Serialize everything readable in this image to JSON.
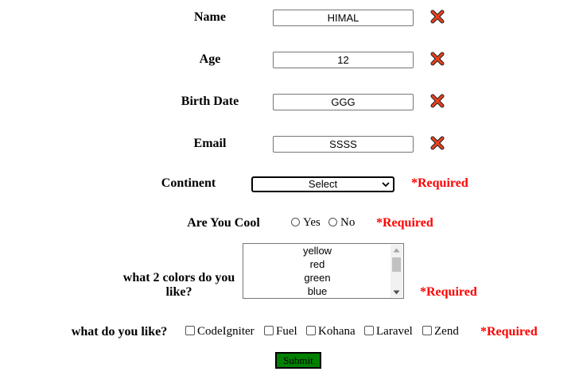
{
  "form": {
    "fields": [
      {
        "label": "Name",
        "value": "HIMAL"
      },
      {
        "label": "Age",
        "value": "12"
      },
      {
        "label": "Birth Date",
        "value": "GGG"
      },
      {
        "label": "Email",
        "value": "SSSS"
      }
    ],
    "continent": {
      "label": "Continent",
      "selected": "Select",
      "required": "*Required"
    },
    "cool": {
      "label": "Are You Cool",
      "options": [
        "Yes",
        "No"
      ],
      "required": "*Required"
    },
    "colors": {
      "label": "what 2 colors do you like?",
      "options": [
        "yellow",
        "red",
        "green",
        "blue"
      ],
      "required": "*Required"
    },
    "likes": {
      "label": "what do you like?",
      "options": [
        "CodeIgniter",
        "Fuel",
        "Kohana",
        "Laravel",
        "Zend"
      ],
      "required": "*Required"
    },
    "submit_label": "Submit"
  },
  "icons": {
    "error": "red-x-icon",
    "dropdown": "chevron-down-icon"
  },
  "colors": {
    "error_icon": "#e8401c",
    "required_text": "#ff0000",
    "submit_bg": "#008000"
  }
}
